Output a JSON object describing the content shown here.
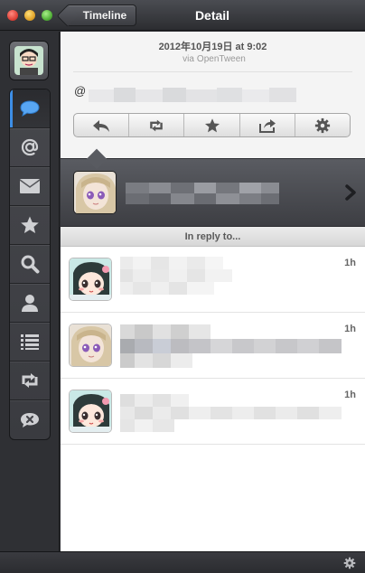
{
  "window": {
    "title": "Detail",
    "back_label": "Timeline"
  },
  "sidebar": {
    "items": [
      {
        "name": "timeline",
        "icon": "speech-bubble-icon",
        "active": true
      },
      {
        "name": "mentions",
        "icon": "at-icon"
      },
      {
        "name": "messages",
        "icon": "envelope-icon"
      },
      {
        "name": "favorites",
        "icon": "star-icon"
      },
      {
        "name": "search",
        "icon": "search-icon"
      },
      {
        "name": "profile",
        "icon": "user-icon"
      },
      {
        "name": "lists",
        "icon": "list-icon"
      },
      {
        "name": "retweets",
        "icon": "retweet-icon"
      },
      {
        "name": "muted",
        "icon": "muted-bubble-icon"
      }
    ]
  },
  "tweet": {
    "date": "2012年10月19日 at 9:02",
    "via_prefix": "via",
    "via_client": "OpenTween",
    "mention_prefix": "@"
  },
  "actions": [
    "reply-icon",
    "retweet-icon",
    "star-icon",
    "share-icon",
    "gear-icon"
  ],
  "reply_section": {
    "header": "In reply to..."
  },
  "replies": [
    {
      "time": "1h"
    },
    {
      "time": "1h"
    },
    {
      "time": "1h"
    }
  ],
  "colors": {
    "accent": "#3d8ee6",
    "sidebar_bg": "#2f3034",
    "titlebar_top": "#4a4c52",
    "author_row": "#4b4d52"
  }
}
